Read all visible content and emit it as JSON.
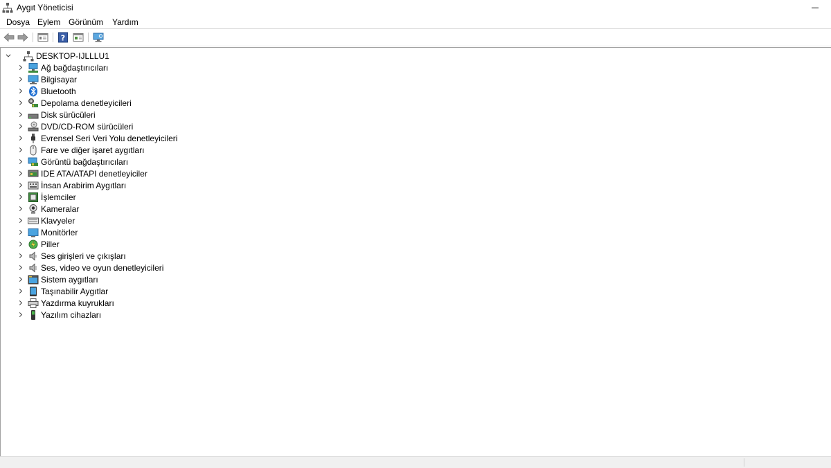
{
  "window": {
    "title": "Aygıt Yöneticisi"
  },
  "menu": [
    "Dosya",
    "Eylem",
    "Görünüm",
    "Yardım"
  ],
  "toolbar": {
    "buttons": [
      "back-arrow-icon",
      "forward-arrow-icon",
      "properties-icon",
      "help-icon",
      "update-driver-icon",
      "scan-hardware-icon"
    ]
  },
  "tree": {
    "root": {
      "label": "DESKTOP-IJLLLU1",
      "icon": "computer-network-icon",
      "expanded": true
    },
    "categories": [
      {
        "label": "Ağ bağdaştırıcıları",
        "icon": "network-adapter-icon"
      },
      {
        "label": "Bilgisayar",
        "icon": "computer-icon"
      },
      {
        "label": "Bluetooth",
        "icon": "bluetooth-icon"
      },
      {
        "label": "Depolama denetleyicileri",
        "icon": "storage-controller-icon"
      },
      {
        "label": "Disk sürücüleri",
        "icon": "disk-drive-icon"
      },
      {
        "label": "DVD/CD-ROM sürücüleri",
        "icon": "dvd-drive-icon"
      },
      {
        "label": "Evrensel Seri Veri Yolu denetleyicileri",
        "icon": "usb-icon"
      },
      {
        "label": "Fare ve diğer işaret aygıtları",
        "icon": "mouse-icon"
      },
      {
        "label": "Görüntü bağdaştırıcıları",
        "icon": "display-adapter-icon"
      },
      {
        "label": "IDE ATA/ATAPI denetleyiciler",
        "icon": "ide-controller-icon"
      },
      {
        "label": "İnsan Arabirim Aygıtları",
        "icon": "hid-icon"
      },
      {
        "label": "İşlemciler",
        "icon": "processor-icon"
      },
      {
        "label": "Kameralar",
        "icon": "camera-icon"
      },
      {
        "label": "Klavyeler",
        "icon": "keyboard-icon"
      },
      {
        "label": "Monitörler",
        "icon": "monitor-icon"
      },
      {
        "label": "Piller",
        "icon": "battery-icon"
      },
      {
        "label": "Ses girişleri ve çıkışları",
        "icon": "speaker-icon"
      },
      {
        "label": "Ses, video ve oyun denetleyicileri",
        "icon": "sound-controller-icon"
      },
      {
        "label": "Sistem aygıtları",
        "icon": "system-device-icon"
      },
      {
        "label": "Taşınabilir Aygıtlar",
        "icon": "portable-device-icon"
      },
      {
        "label": "Yazdırma kuyrukları",
        "icon": "printer-icon"
      },
      {
        "label": "Yazılım cihazları",
        "icon": "software-device-icon"
      }
    ]
  }
}
